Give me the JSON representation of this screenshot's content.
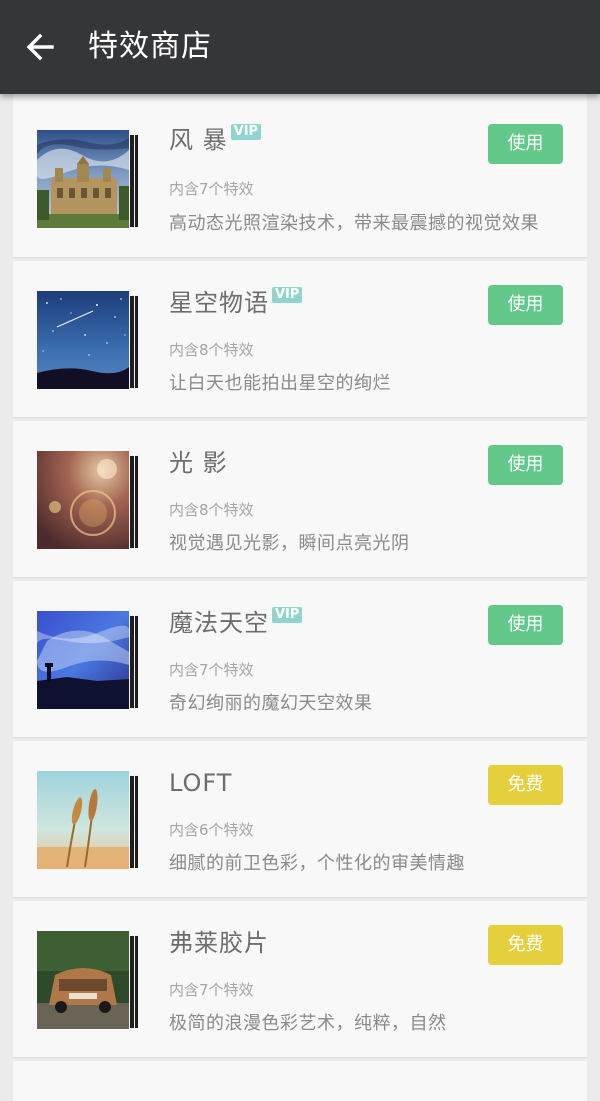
{
  "header": {
    "back_icon": "arrow-left-icon",
    "title": "特效商店",
    "background": "#353637"
  },
  "colors": {
    "use_button": "#62c98a",
    "free_button": "#e6cf3d",
    "vip_badge": "#8fd4cf"
  },
  "items": [
    {
      "name": "风 暴",
      "vip": "VIP",
      "count": "内含7个特效",
      "desc": "高动态光照渲染技术，带来最震撼的视觉效果",
      "action": "使用",
      "thumb": "castle-storm-image"
    },
    {
      "name": "星空物语",
      "vip": "VIP",
      "count": "内含8个特效",
      "desc": "让白天也能拍出星空的绚烂",
      "action": "使用",
      "thumb": "starry-sky-image"
    },
    {
      "name": "光 影",
      "vip": "",
      "count": "内含8个特效",
      "desc": "视觉遇见光影，瞬间点亮光阴",
      "action": "使用",
      "thumb": "light-flare-image"
    },
    {
      "name": "魔法天空",
      "vip": "VIP",
      "count": "内含7个特效",
      "desc": "奇幻绚丽的魔幻天空效果",
      "action": "使用",
      "thumb": "magic-sky-image"
    },
    {
      "name": "LOFT",
      "vip": "",
      "count": "内含6个特效",
      "desc": "细腻的前卫色彩，个性化的审美情趣",
      "action": "免费",
      "thumb": "wheat-image"
    },
    {
      "name": "弗莱胶片",
      "vip": "",
      "count": "内含7个特效",
      "desc": "极简的浪漫色彩艺术，纯粹，自然",
      "action": "免费",
      "thumb": "vintage-car-image"
    }
  ]
}
